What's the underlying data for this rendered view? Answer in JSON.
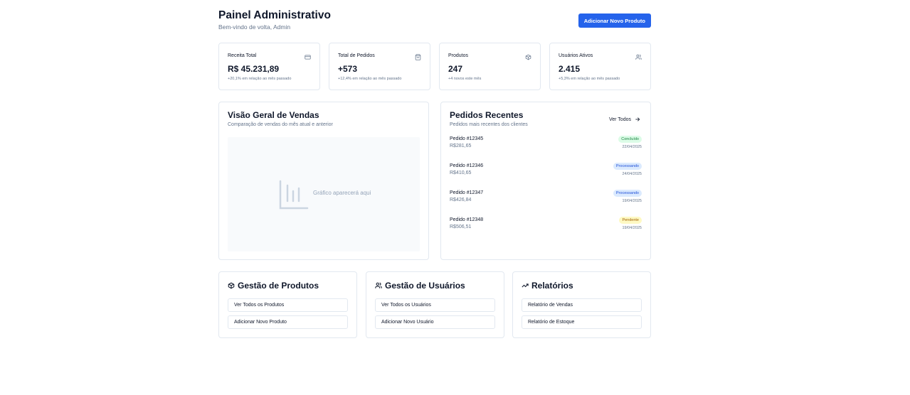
{
  "header": {
    "title": "Painel Administrativo",
    "subtitle": "Bem-vindo de volta, Admin",
    "add_product_label": "Adicionar Novo Produto"
  },
  "colors": {
    "accent": "#2563eb",
    "border": "#e2e8f0",
    "muted": "#64748b"
  },
  "stats": [
    {
      "label": "Receita Total",
      "value": "R$ 45.231,89",
      "note": "+20,1% em relação ao mês passado",
      "icon": "credit-card-icon"
    },
    {
      "label": "Total de Pedidos",
      "value": "+573",
      "note": "+12,4% em relação ao mês passado",
      "icon": "shopping-bag-icon"
    },
    {
      "label": "Produtos",
      "value": "247",
      "note": "+4 novos este mês",
      "icon": "package-icon"
    },
    {
      "label": "Usuários Ativos",
      "value": "2.415",
      "note": "+5,3% em relação ao mês passado",
      "icon": "users-icon"
    }
  ],
  "sales": {
    "title": "Visão Geral de Vendas",
    "subtitle": "Comparação de vendas do mês atual e anterior",
    "placeholder": "Gráfico aparecerá aqui",
    "icon": "bar-chart-icon"
  },
  "orders": {
    "title": "Pedidos Recentes",
    "subtitle": "Pedidos mais recentes dos clientes",
    "view_all": "Ver Todos",
    "items": [
      {
        "id": "Pedido #12345",
        "amount": "R$281,65",
        "status": "Concluído",
        "date": "22/04/2025",
        "status_bg": "#dcfce7",
        "status_fg": "#15803d"
      },
      {
        "id": "Pedido #12346",
        "amount": "R$410,65",
        "status": "Processando",
        "date": "24/04/2025",
        "status_bg": "#dbeafe",
        "status_fg": "#1d4ed8"
      },
      {
        "id": "Pedido #12347",
        "amount": "R$426,84",
        "status": "Processando",
        "date": "19/04/2025",
        "status_bg": "#dbeafe",
        "status_fg": "#1d4ed8"
      },
      {
        "id": "Pedido #12348",
        "amount": "R$506,51",
        "status": "Pendente",
        "date": "19/04/2025",
        "status_bg": "#fef9c3",
        "status_fg": "#a16207"
      }
    ]
  },
  "sections": [
    {
      "title": "Gestão de Produtos",
      "icon": "package-icon",
      "buttons": [
        "Ver Todos os Produtos",
        "Adicionar Novo Produto"
      ]
    },
    {
      "title": "Gestão de Usuários",
      "icon": "users-icon",
      "buttons": [
        "Ver Todos os Usuários",
        "Adicionar Novo Usuário"
      ]
    },
    {
      "title": "Relatórios",
      "icon": "trending-up-icon",
      "buttons": [
        "Relatório de Vendas",
        "Relatório de Estoque"
      ]
    }
  ]
}
